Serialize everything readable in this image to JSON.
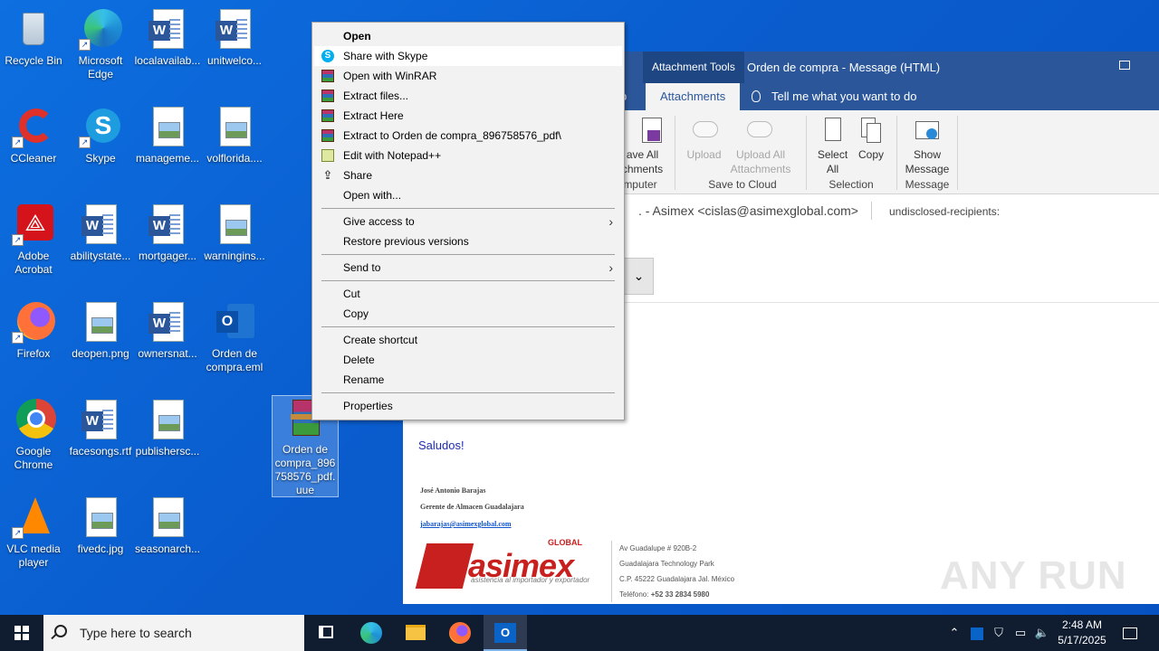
{
  "desktop": {
    "icons": [
      {
        "label": "Recycle Bin"
      },
      {
        "label": "Microsoft Edge"
      },
      {
        "label": "localavailab..."
      },
      {
        "label": "unitwelco..."
      },
      {
        "label": "CCleaner"
      },
      {
        "label": "Skype"
      },
      {
        "label": "manageme..."
      },
      {
        "label": "volflorida...."
      },
      {
        "label": "Adobe Acrobat"
      },
      {
        "label": "abilitystate..."
      },
      {
        "label": "mortgager..."
      },
      {
        "label": "warningins..."
      },
      {
        "label": "Firefox"
      },
      {
        "label": "deopen.png"
      },
      {
        "label": "ownersnat..."
      },
      {
        "label": "Orden de compra.eml"
      },
      {
        "label": "Google Chrome"
      },
      {
        "label": "facesongs.rtf"
      },
      {
        "label": "publishersc..."
      },
      {
        "label": "Orden de compra_896758576_pdf.uue"
      },
      {
        "label": "VLC media player"
      },
      {
        "label": "fivedc.jpg"
      },
      {
        "label": "seasonarch..."
      }
    ]
  },
  "outlook": {
    "title_attachment_tools": "Attachment Tools",
    "title_message": "Orden de compra  -  Message (HTML)",
    "tab_partial": "p",
    "tab_attachments": "Attachments",
    "tell_me": "Tell me what you want to do",
    "ribbon": {
      "save_all_line1": "ave All",
      "save_all_line2": "chments",
      "group_computer": "mputer",
      "upload": "Upload",
      "upload_all_line1": "Upload All",
      "upload_all_line2": "Attachments",
      "group_save_cloud": "Save to Cloud",
      "select_all_line1": "Select",
      "select_all_line2": "All",
      "copy": "Copy",
      "group_selection": "Selection",
      "show_message_line1": "Show",
      "show_message_line2": "Message",
      "group_message": "Message"
    },
    "from": ". - Asimex <cislas@asimexglobal.com>",
    "to": "undisclosed-recipients:",
    "attachment_partial": "e",
    "body_greeting": "Saludos!",
    "signature": {
      "name": "José Antonio Barajas",
      "role": "Gerente de Almacen Guadalajara",
      "email": "jabarajas@asimexglobal.com",
      "logo_text": "asimex",
      "logo_global": "GLOBAL",
      "logo_tagline": "asistencia al importador y exportador",
      "addr1": "Av Guadalupe # 920B-2",
      "addr2": "Guadalajara Technology Park",
      "addr3": "C.P. 45222 Guadalajara Jal. México",
      "phone_label": "Teléfono:",
      "phone": "+52 33 2834 5980"
    }
  },
  "context_menu": {
    "items": [
      {
        "label": "Open"
      },
      {
        "label": "Share with Skype"
      },
      {
        "label": "Open with WinRAR"
      },
      {
        "label": "Extract files..."
      },
      {
        "label": "Extract Here"
      },
      {
        "label": "Extract to Orden de compra_896758576_pdf\\"
      },
      {
        "label": "Edit with Notepad++"
      },
      {
        "label": "Share"
      },
      {
        "label": "Open with..."
      },
      {
        "label": "Give access to"
      },
      {
        "label": "Restore previous versions"
      },
      {
        "label": "Send to"
      },
      {
        "label": "Cut"
      },
      {
        "label": "Copy"
      },
      {
        "label": "Create shortcut"
      },
      {
        "label": "Delete"
      },
      {
        "label": "Rename"
      },
      {
        "label": "Properties"
      }
    ]
  },
  "taskbar": {
    "search_placeholder": "Type here to search",
    "time": "2:48 AM",
    "date": "5/17/2025"
  },
  "watermark": "ANY RUN"
}
